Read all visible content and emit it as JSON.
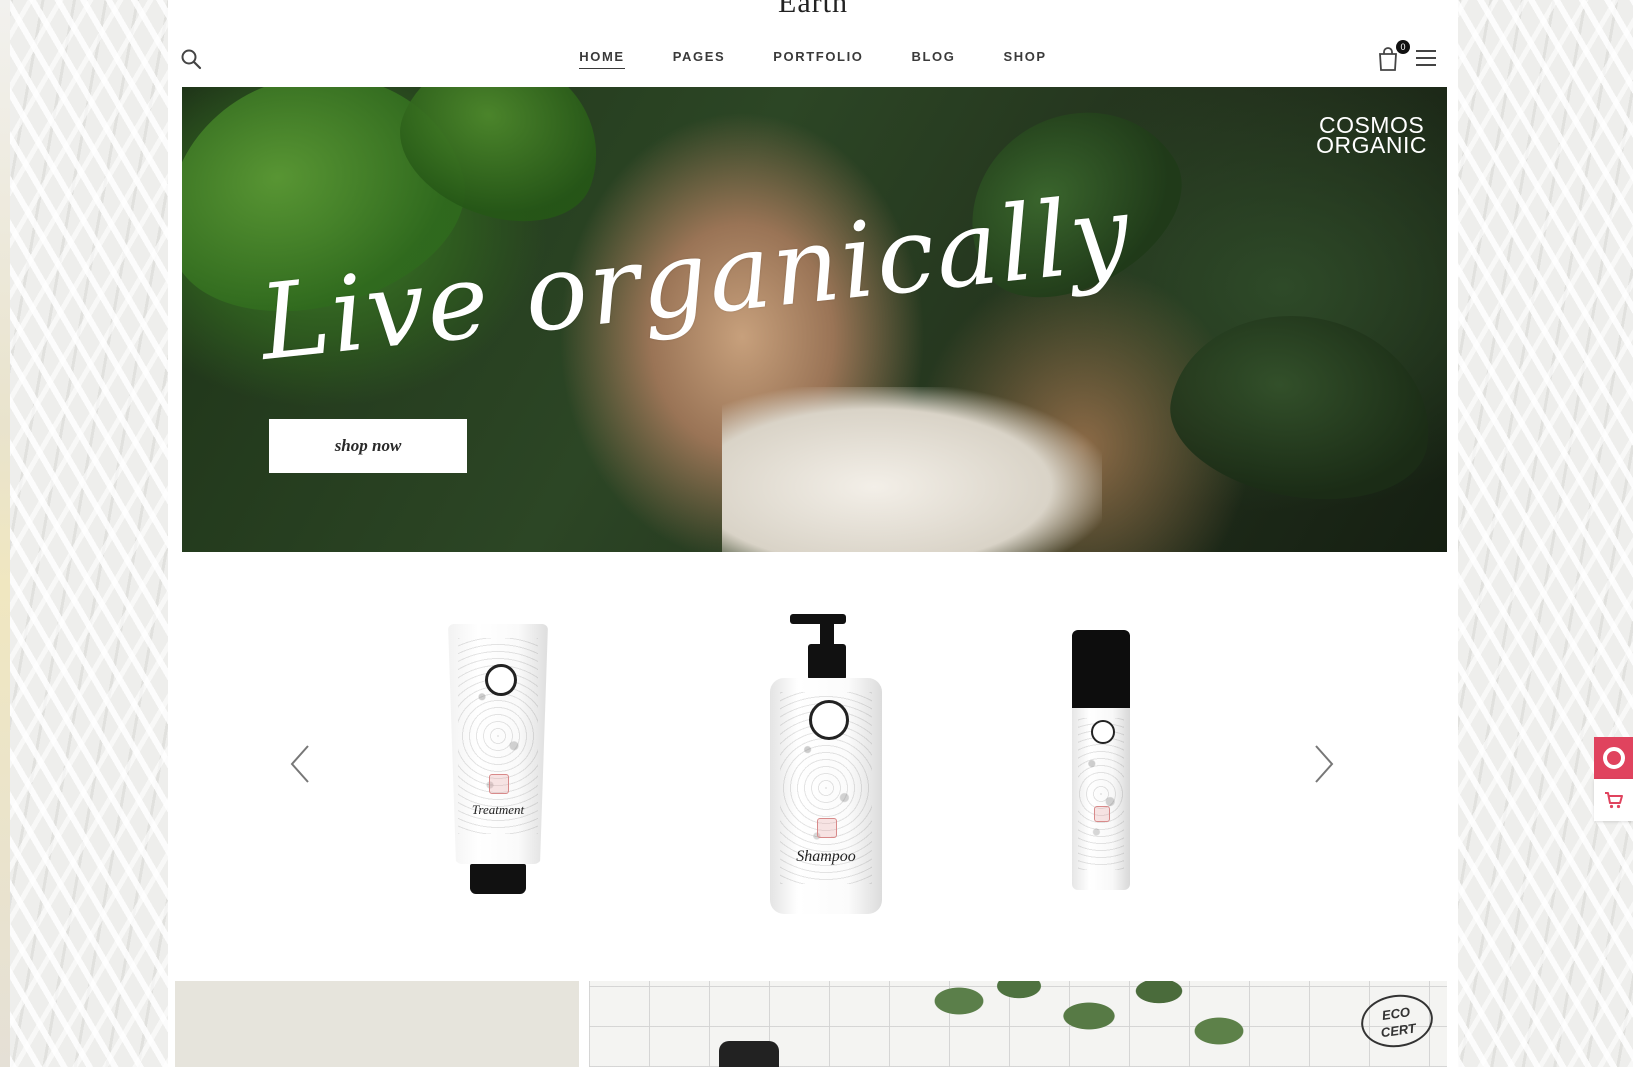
{
  "site": {
    "title": "Earth"
  },
  "nav": {
    "items": [
      {
        "label": "HOME",
        "active": true
      },
      {
        "label": "PAGES",
        "active": false
      },
      {
        "label": "PORTFOLIO",
        "active": false
      },
      {
        "label": "BLOG",
        "active": false
      },
      {
        "label": "SHOP",
        "active": false
      }
    ],
    "cart_count": "0",
    "icons": [
      "search-icon",
      "shopping-bag-icon",
      "hamburger-menu-icon"
    ]
  },
  "hero": {
    "badge_line1": "COSMOS",
    "badge_line2": "ORGANIC",
    "script_text": "Live organically",
    "button_label": "shop now"
  },
  "products": {
    "items": [
      {
        "type": "tube",
        "label": "Treatment"
      },
      {
        "type": "pump-bottle",
        "label": "Shampoo"
      },
      {
        "type": "spray-bottle",
        "label": ""
      }
    ],
    "icons": [
      "chevron-left-icon",
      "chevron-right-icon"
    ]
  },
  "bottom": {
    "badge_line1": "ECO",
    "badge_line2": "CERT"
  },
  "side_widget": {
    "icons": [
      "lifebuoy-icon",
      "cart-icon"
    ],
    "accent": "#e0435e"
  },
  "colors": {
    "page_bg": "#ffffff",
    "text": "#3a3a3a",
    "accent": "#e0435e",
    "beige": "#e6e4dc"
  }
}
